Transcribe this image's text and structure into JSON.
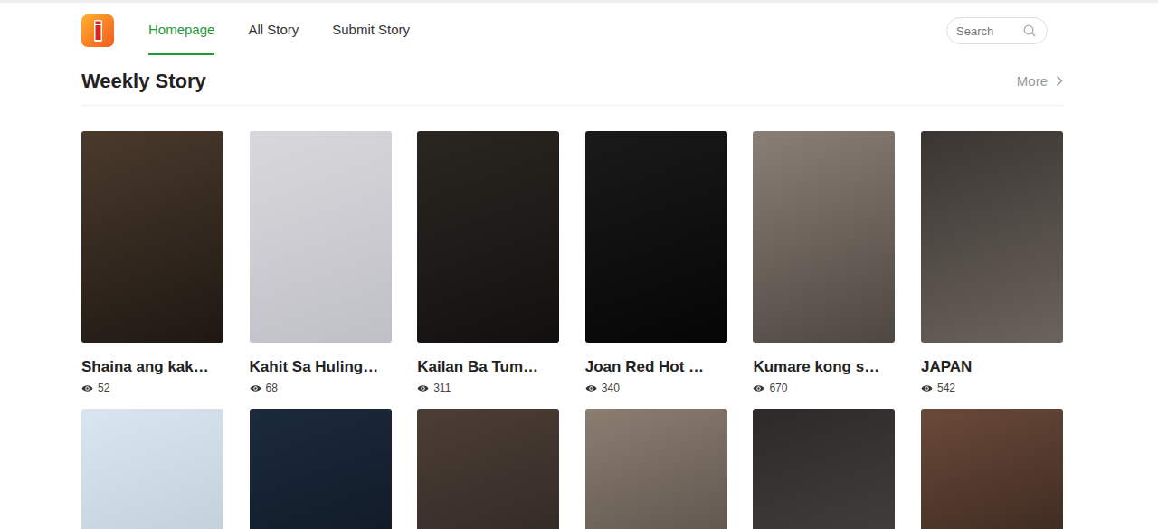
{
  "header": {
    "nav": [
      {
        "label": "Homepage",
        "selected": true
      },
      {
        "label": "All Story",
        "selected": false
      },
      {
        "label": "Submit Story",
        "selected": false
      }
    ],
    "search": {
      "placeholder": "Search"
    }
  },
  "section": {
    "title": "Weekly Story",
    "more": "More"
  },
  "stories": [
    {
      "title": "Shaina ang kak…",
      "views": "52"
    },
    {
      "title": "Kahit Sa Huling…",
      "views": "68"
    },
    {
      "title": "Kailan Ba Tum…",
      "views": "311"
    },
    {
      "title": "Joan Red Hot …",
      "views": "340"
    },
    {
      "title": "Kumare kong s…",
      "views": "670"
    },
    {
      "title": "JAPAN",
      "views": "542"
    }
  ],
  "more_stories": [
    {},
    {},
    {},
    {},
    {},
    {}
  ]
}
